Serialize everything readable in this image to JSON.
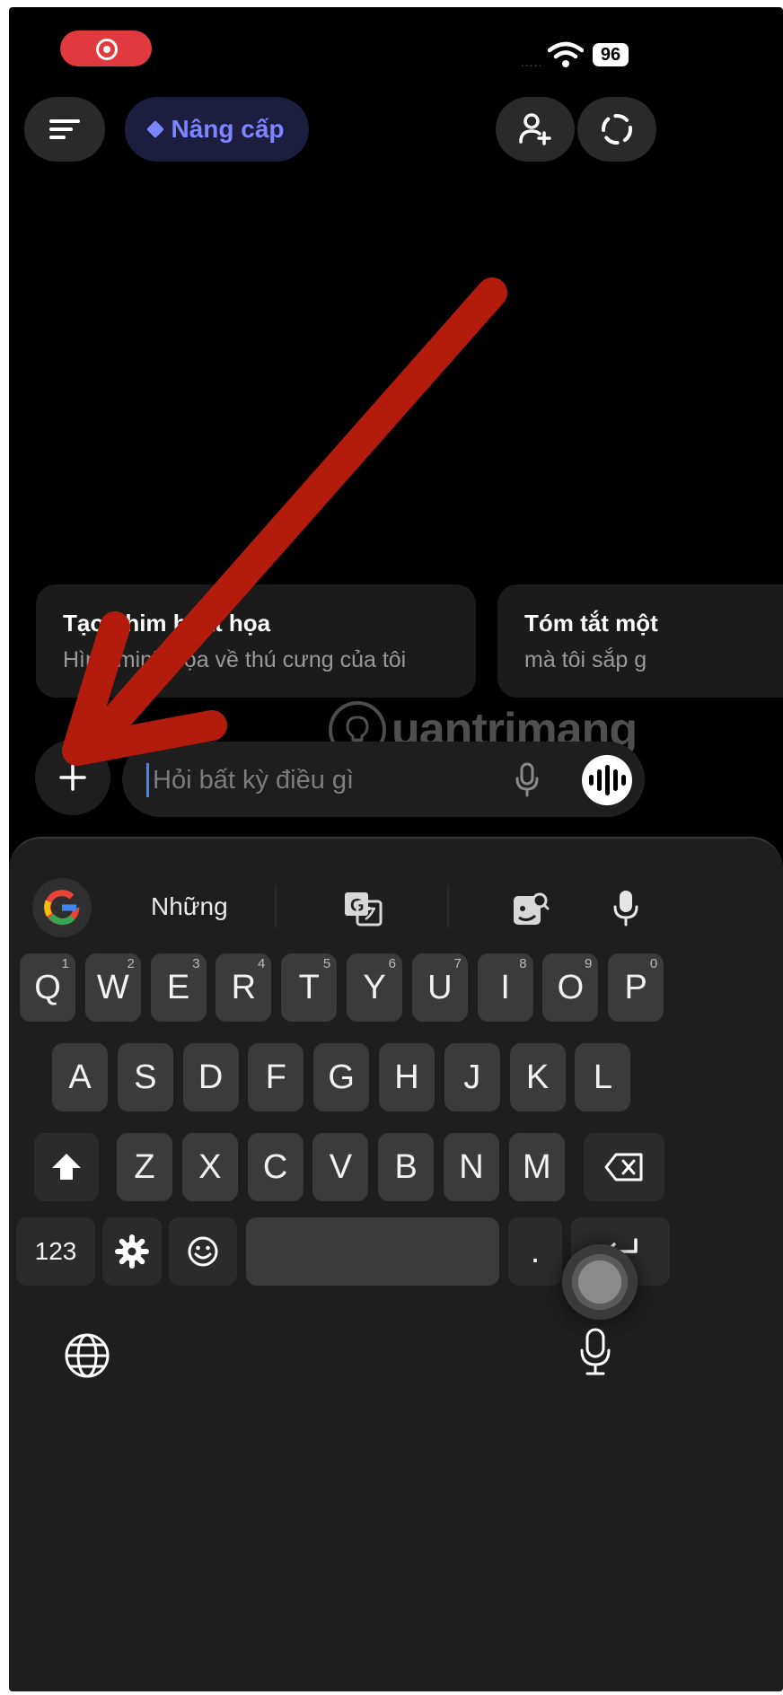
{
  "status_bar": {
    "battery": "96",
    "signal": "....."
  },
  "header": {
    "upgrade_label": "Nâng cấp"
  },
  "suggestions": [
    {
      "title": "Tạo phim hoạt họa",
      "subtitle": "Hình minh họa về thú cưng của tôi"
    },
    {
      "title": "Tóm tắt một",
      "subtitle": "mà tôi sắp g"
    }
  ],
  "watermark": {
    "text": "uantrimang"
  },
  "composer": {
    "placeholder": "Hỏi bất kỳ điều gì"
  },
  "keyboard": {
    "suggestion": "Những",
    "rows": [
      [
        {
          "label": "Q",
          "hint": "1"
        },
        {
          "label": "W",
          "hint": "2"
        },
        {
          "label": "E",
          "hint": "3"
        },
        {
          "label": "R",
          "hint": "4"
        },
        {
          "label": "T",
          "hint": "5"
        },
        {
          "label": "Y",
          "hint": "6"
        },
        {
          "label": "U",
          "hint": "7"
        },
        {
          "label": "I",
          "hint": "8"
        },
        {
          "label": "O",
          "hint": "9"
        },
        {
          "label": "P",
          "hint": "0"
        }
      ],
      [
        {
          "label": "A"
        },
        {
          "label": "S"
        },
        {
          "label": "D"
        },
        {
          "label": "F"
        },
        {
          "label": "G"
        },
        {
          "label": "H"
        },
        {
          "label": "J"
        },
        {
          "label": "K"
        },
        {
          "label": "L"
        }
      ],
      [
        {
          "label": "Z"
        },
        {
          "label": "X"
        },
        {
          "label": "C"
        },
        {
          "label": "V"
        },
        {
          "label": "B"
        },
        {
          "label": "N"
        },
        {
          "label": "M"
        }
      ]
    ],
    "numbers_label": "123",
    "period_label": "."
  },
  "colors": {
    "accent": "#7b86ff",
    "record": "#e0393e",
    "annotation_arrow": "#b31c0c"
  }
}
